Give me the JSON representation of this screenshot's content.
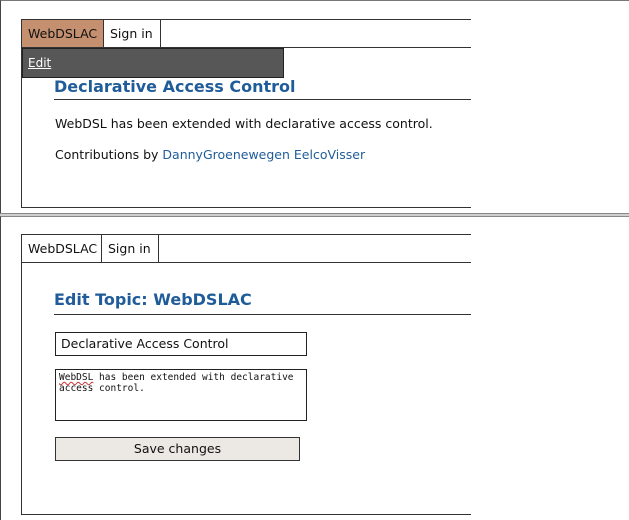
{
  "view_page": {
    "nav": {
      "home_label": "WebDSLAC",
      "signin_label": "Sign in"
    },
    "edit_link": "Edit",
    "title": "Declarative Access Control",
    "body": "WebDSL has been extended with declarative access control.",
    "contributions_prefix": "Contributions by",
    "contributors": [
      "DannyGroenewegen",
      "EelcoVisser"
    ]
  },
  "edit_page": {
    "nav": {
      "home_label": "WebDSLAC",
      "signin_label": "Sign in"
    },
    "heading": "Edit Topic: WebDSLAC",
    "title_value": "Declarative Access Control",
    "text_value_first_word": "WebDSL",
    "text_value_rest": " has been extended with declarative\naccess control.",
    "save_label": "Save changes"
  },
  "colors": {
    "accent_link": "#1f5c99",
    "active_tab": "#c4906f",
    "edit_bar": "#575757",
    "button_bg": "#ece9e4"
  }
}
